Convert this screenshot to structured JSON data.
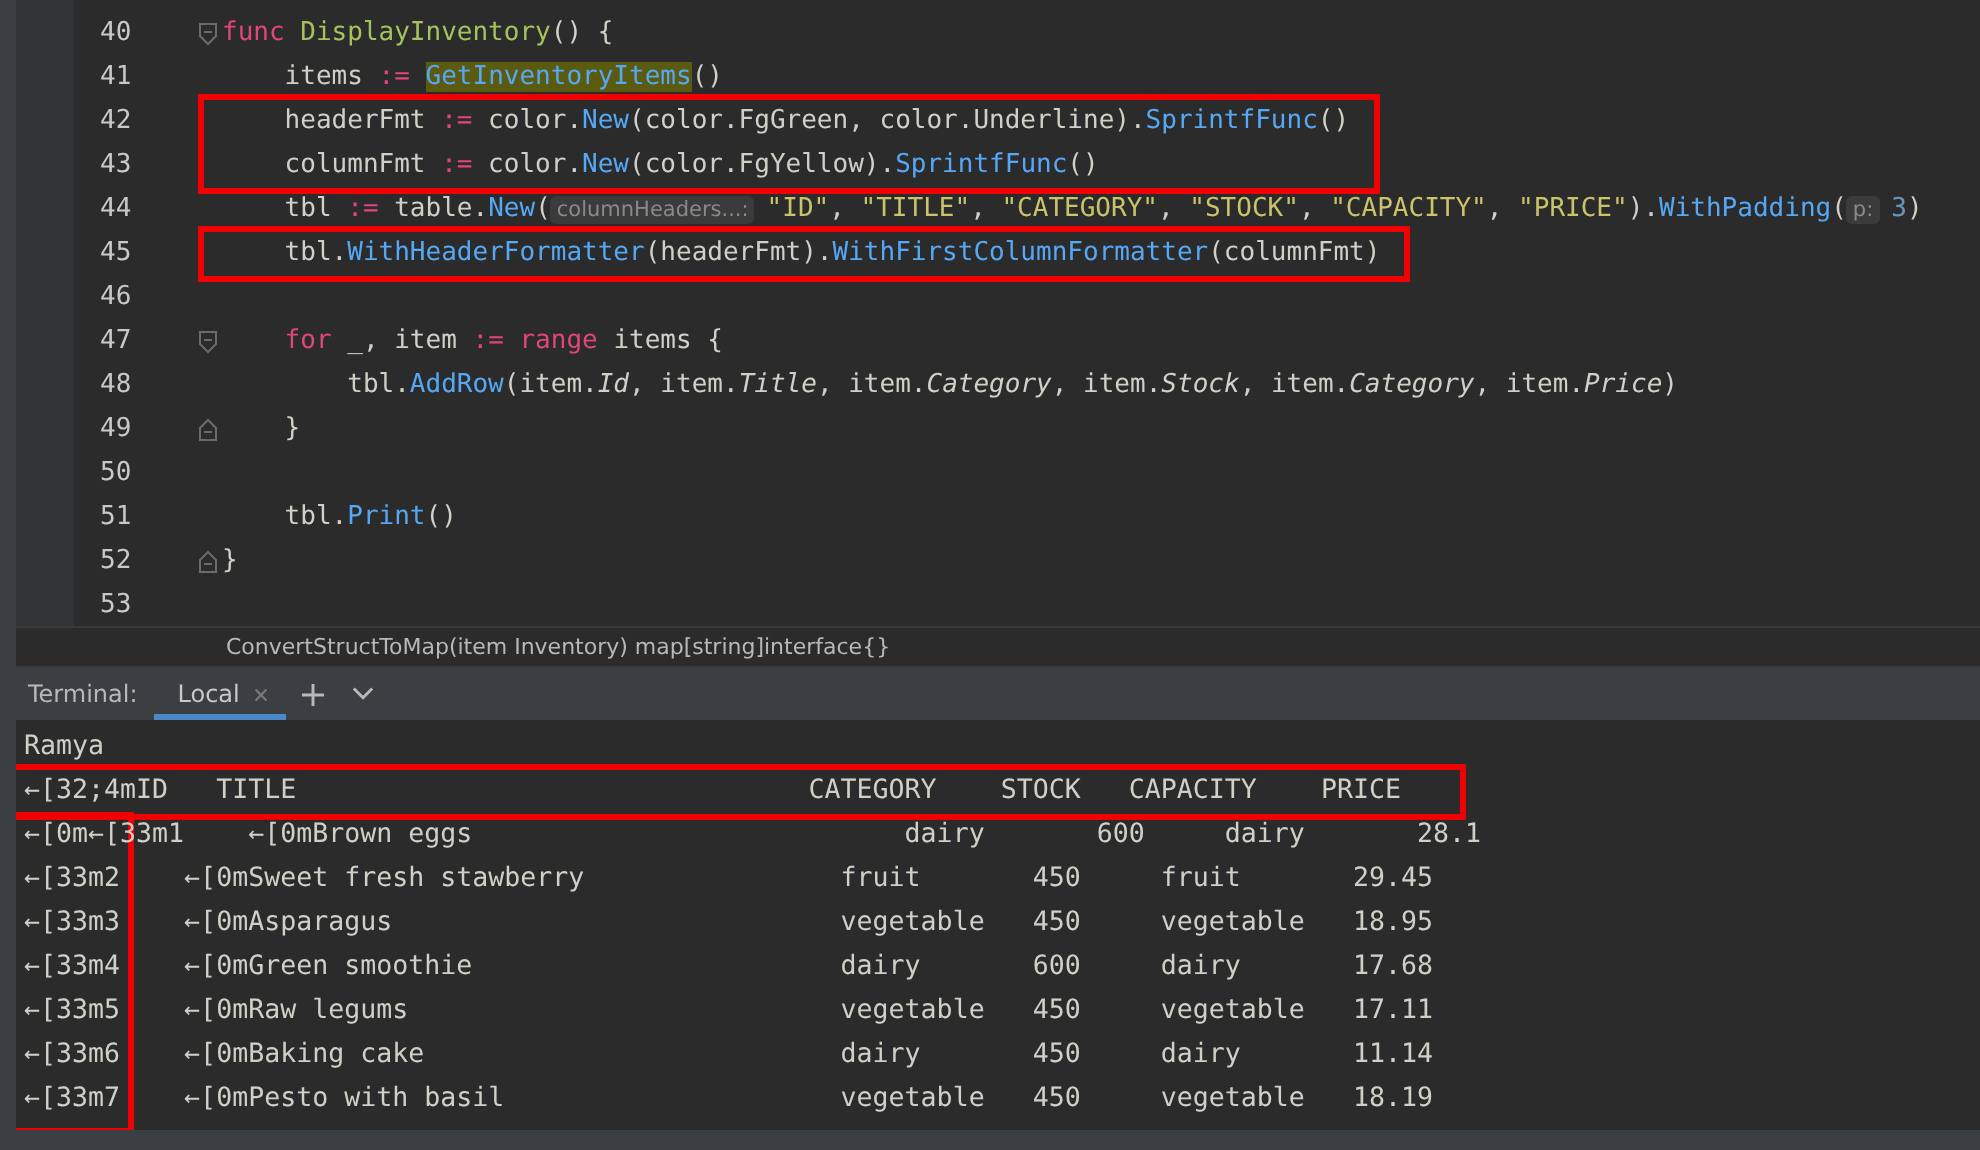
{
  "editor": {
    "lines": [
      {
        "number": "40",
        "fold_start": true,
        "tokens": [
          {
            "t": "func ",
            "kind": "kw"
          },
          {
            "t": "DisplayInventory",
            "kind": "decl"
          },
          {
            "t": "() {",
            "kind": "plain"
          }
        ]
      },
      {
        "number": "41",
        "tokens": [
          {
            "t": "    items ",
            "kind": "plain"
          },
          {
            "t": ":= ",
            "kind": "op"
          },
          {
            "t": "GetInventoryItems",
            "kind": "hl"
          },
          {
            "t": "()",
            "kind": "plain"
          }
        ]
      },
      {
        "number": "42",
        "boxed": true,
        "tokens": [
          {
            "t": "    headerFmt ",
            "kind": "plain"
          },
          {
            "t": ":=",
            "kind": "op"
          },
          {
            "t": " color.",
            "kind": "plain"
          },
          {
            "t": "New",
            "kind": "call"
          },
          {
            "t": "(color.FgGreen, color.Underline).",
            "kind": "plain"
          },
          {
            "t": "SprintfFunc",
            "kind": "call"
          },
          {
            "t": "()",
            "kind": "plain"
          }
        ]
      },
      {
        "number": "43",
        "boxed": true,
        "tokens": [
          {
            "t": "    columnFmt ",
            "kind": "plain"
          },
          {
            "t": ":=",
            "kind": "op"
          },
          {
            "t": " color.",
            "kind": "plain"
          },
          {
            "t": "New",
            "kind": "call"
          },
          {
            "t": "(color.FgYellow).",
            "kind": "plain"
          },
          {
            "t": "SprintfFunc",
            "kind": "call"
          },
          {
            "t": "()",
            "kind": "plain"
          }
        ]
      },
      {
        "number": "44",
        "tokens": [
          {
            "t": "    tbl ",
            "kind": "plain"
          },
          {
            "t": ":=",
            "kind": "op"
          },
          {
            "t": " table.",
            "kind": "plain"
          },
          {
            "t": "New",
            "kind": "call"
          },
          {
            "t": "(",
            "kind": "plain"
          },
          {
            "t": "columnHeaders...:",
            "kind": "hint"
          },
          {
            "t": "\"ID\"",
            "kind": "str"
          },
          {
            "t": ", ",
            "kind": "plain"
          },
          {
            "t": "\"TITLE\"",
            "kind": "str"
          },
          {
            "t": ", ",
            "kind": "plain"
          },
          {
            "t": "\"CATEGORY\"",
            "kind": "str"
          },
          {
            "t": ", ",
            "kind": "plain"
          },
          {
            "t": "\"STOCK\"",
            "kind": "str"
          },
          {
            "t": ", ",
            "kind": "plain"
          },
          {
            "t": "\"CAPACITY\"",
            "kind": "str"
          },
          {
            "t": ", ",
            "kind": "plain"
          },
          {
            "t": "\"PRICE\"",
            "kind": "str"
          },
          {
            "t": ").",
            "kind": "plain"
          },
          {
            "t": "WithPadding",
            "kind": "call"
          },
          {
            "t": "(",
            "kind": "plain"
          },
          {
            "t": "p:",
            "kind": "hint"
          },
          {
            "t": "3",
            "kind": "num"
          },
          {
            "t": ")",
            "kind": "plain"
          }
        ]
      },
      {
        "number": "45",
        "boxed": true,
        "tokens": [
          {
            "t": "    tbl.",
            "kind": "plain"
          },
          {
            "t": "WithHeaderFormatter",
            "kind": "call"
          },
          {
            "t": "(headerFmt).",
            "kind": "plain"
          },
          {
            "t": "WithFirstColumnFormatter",
            "kind": "call"
          },
          {
            "t": "(columnFmt)",
            "kind": "plain"
          }
        ]
      },
      {
        "number": "46"
      },
      {
        "number": "47",
        "fold_start": true,
        "tokens": [
          {
            "t": "    for",
            "kind": "kw"
          },
          {
            "t": " _, item ",
            "kind": "plain"
          },
          {
            "t": ":= range",
            "kind": "kw"
          },
          {
            "t": " items {",
            "kind": "plain"
          }
        ]
      },
      {
        "number": "48",
        "tokens": [
          {
            "t": "        tbl.",
            "kind": "plain"
          },
          {
            "t": "AddRow",
            "kind": "call"
          },
          {
            "t": "(item.",
            "kind": "plain"
          },
          {
            "t": "Id",
            "kind": "field"
          },
          {
            "t": ", item.",
            "kind": "plain"
          },
          {
            "t": "Title",
            "kind": "field"
          },
          {
            "t": ", item.",
            "kind": "plain"
          },
          {
            "t": "Category",
            "kind": "field"
          },
          {
            "t": ", item.",
            "kind": "plain"
          },
          {
            "t": "Stock",
            "kind": "field"
          },
          {
            "t": ", item.",
            "kind": "plain"
          },
          {
            "t": "Category",
            "kind": "field"
          },
          {
            "t": ", item.",
            "kind": "plain"
          },
          {
            "t": "Price",
            "kind": "field"
          },
          {
            "t": ")",
            "kind": "plain"
          }
        ]
      },
      {
        "number": "49",
        "fold_end": true,
        "tokens": [
          {
            "t": "    }",
            "kind": "plain"
          }
        ]
      },
      {
        "number": "50"
      },
      {
        "number": "51",
        "tokens": [
          {
            "t": "    tbl.",
            "kind": "plain"
          },
          {
            "t": "Print",
            "kind": "call"
          },
          {
            "t": "()",
            "kind": "plain"
          }
        ]
      },
      {
        "number": "52",
        "fold_end": true,
        "tokens": [
          {
            "t": "}",
            "kind": "plain"
          }
        ]
      },
      {
        "number": "53"
      }
    ]
  },
  "breadcrumb": "ConvertStructToMap(item Inventory) map[string]interface{}",
  "terminal": {
    "label": "Terminal:",
    "tabs": [
      {
        "label": "Local",
        "selected": true
      }
    ],
    "lines": [
      {
        "kind": "text",
        "cells": [
          "Ramya"
        ]
      },
      {
        "kind": "header",
        "cells": [
          "←[32;4mID",
          "TITLE",
          "CATEGORY",
          "STOCK",
          "CAPACITY",
          "PRICE"
        ]
      },
      {
        "kind": "first",
        "cells": [
          "←[0m←[33m1",
          "←[0mBrown eggs",
          "dairy",
          "600",
          "dairy",
          "28.1"
        ]
      },
      {
        "kind": "row",
        "cells": [
          "←[33m2",
          "←[0mSweet fresh stawberry",
          "fruit",
          "450",
          "fruit",
          "29.45"
        ]
      },
      {
        "kind": "row",
        "cells": [
          "←[33m3",
          "←[0mAsparagus",
          "vegetable",
          "450",
          "vegetable",
          "18.95"
        ]
      },
      {
        "kind": "row",
        "cells": [
          "←[33m4",
          "←[0mGreen smoothie",
          "dairy",
          "600",
          "dairy",
          "17.68"
        ]
      },
      {
        "kind": "row",
        "cells": [
          "←[33m5",
          "←[0mRaw legums",
          "vegetable",
          "450",
          "vegetable",
          "17.11"
        ]
      },
      {
        "kind": "row",
        "cells": [
          "←[33m6",
          "←[0mBaking cake",
          "dairy",
          "450",
          "dairy",
          "11.14"
        ]
      },
      {
        "kind": "row",
        "cells": [
          "←[33m7",
          "←[0mPesto with basil",
          "vegetable",
          "450",
          "vegetable",
          "18.19"
        ]
      }
    ],
    "header_boxed": true,
    "id_column_boxed": true
  }
}
